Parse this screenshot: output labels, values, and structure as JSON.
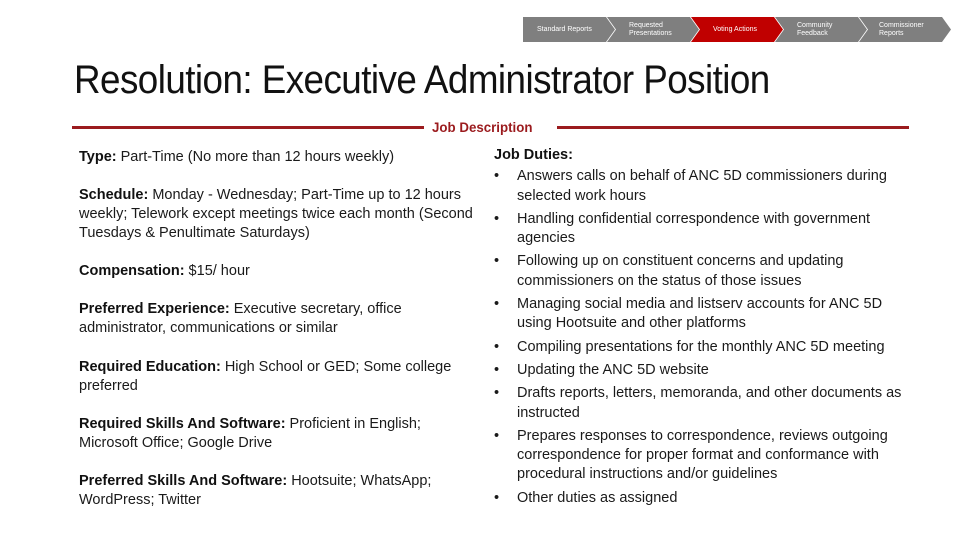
{
  "nav": {
    "items": [
      {
        "label": "Standard Reports",
        "active": false
      },
      {
        "label": "Requested Presentations",
        "active": false
      },
      {
        "label": "Voting Actions",
        "active": true
      },
      {
        "label": "Community Feedback",
        "active": false
      },
      {
        "label": "Commissioner Reports",
        "active": false
      }
    ],
    "colors": {
      "inactive": "#7f7f7f",
      "active": "#c00000"
    }
  },
  "page": {
    "title": "Resolution: Executive Administrator Position",
    "section_label": "Job Description",
    "accent_color": "#9b1b1e"
  },
  "details": [
    {
      "label": "Type:",
      "value": " Part-Time (No more than  12 hours weekly)"
    },
    {
      "label": "Schedule:",
      "value": " Monday - Wednesday; Part-Time up to 12 hours weekly; Telework  except meetings twice each month (Second Tuesdays & Penultimate Saturdays)"
    },
    {
      "label": "Compensation:",
      "value": " $15/ hour"
    },
    {
      "label": "Preferred Experience:",
      "value": " Executive secretary, office administrator, communications or similar"
    },
    {
      "label": "Required Education:",
      "value": " High School or GED; Some college preferred"
    },
    {
      "label": "Required Skills And Software:",
      "value": " Proficient in English; Microsoft Office; Google Drive"
    },
    {
      "label": "Preferred Skills And Software:",
      "value": " Hootsuite; WhatsApp; WordPress; Twitter"
    }
  ],
  "duties": {
    "heading": "Job Duties:",
    "bullet": "•",
    "items": [
      "Answers calls on behalf of ANC 5D commissioners during selected work hours",
      "Handling confidential correspondence with government agencies",
      "Following up on constituent concerns and updating commissioners on the status of those issues",
      "Managing social media and listserv accounts for ANC 5D using Hootsuite and other platforms",
      "Compiling presentations for the monthly ANC 5D meeting",
      "Updating the ANC 5D website",
      "Drafts reports, letters, memoranda, and other documents as instructed",
      "Prepares responses to correspondence, reviews outgoing correspondence for proper format and conformance with procedural instructions and/or guidelines",
      "Other duties as assigned"
    ]
  }
}
